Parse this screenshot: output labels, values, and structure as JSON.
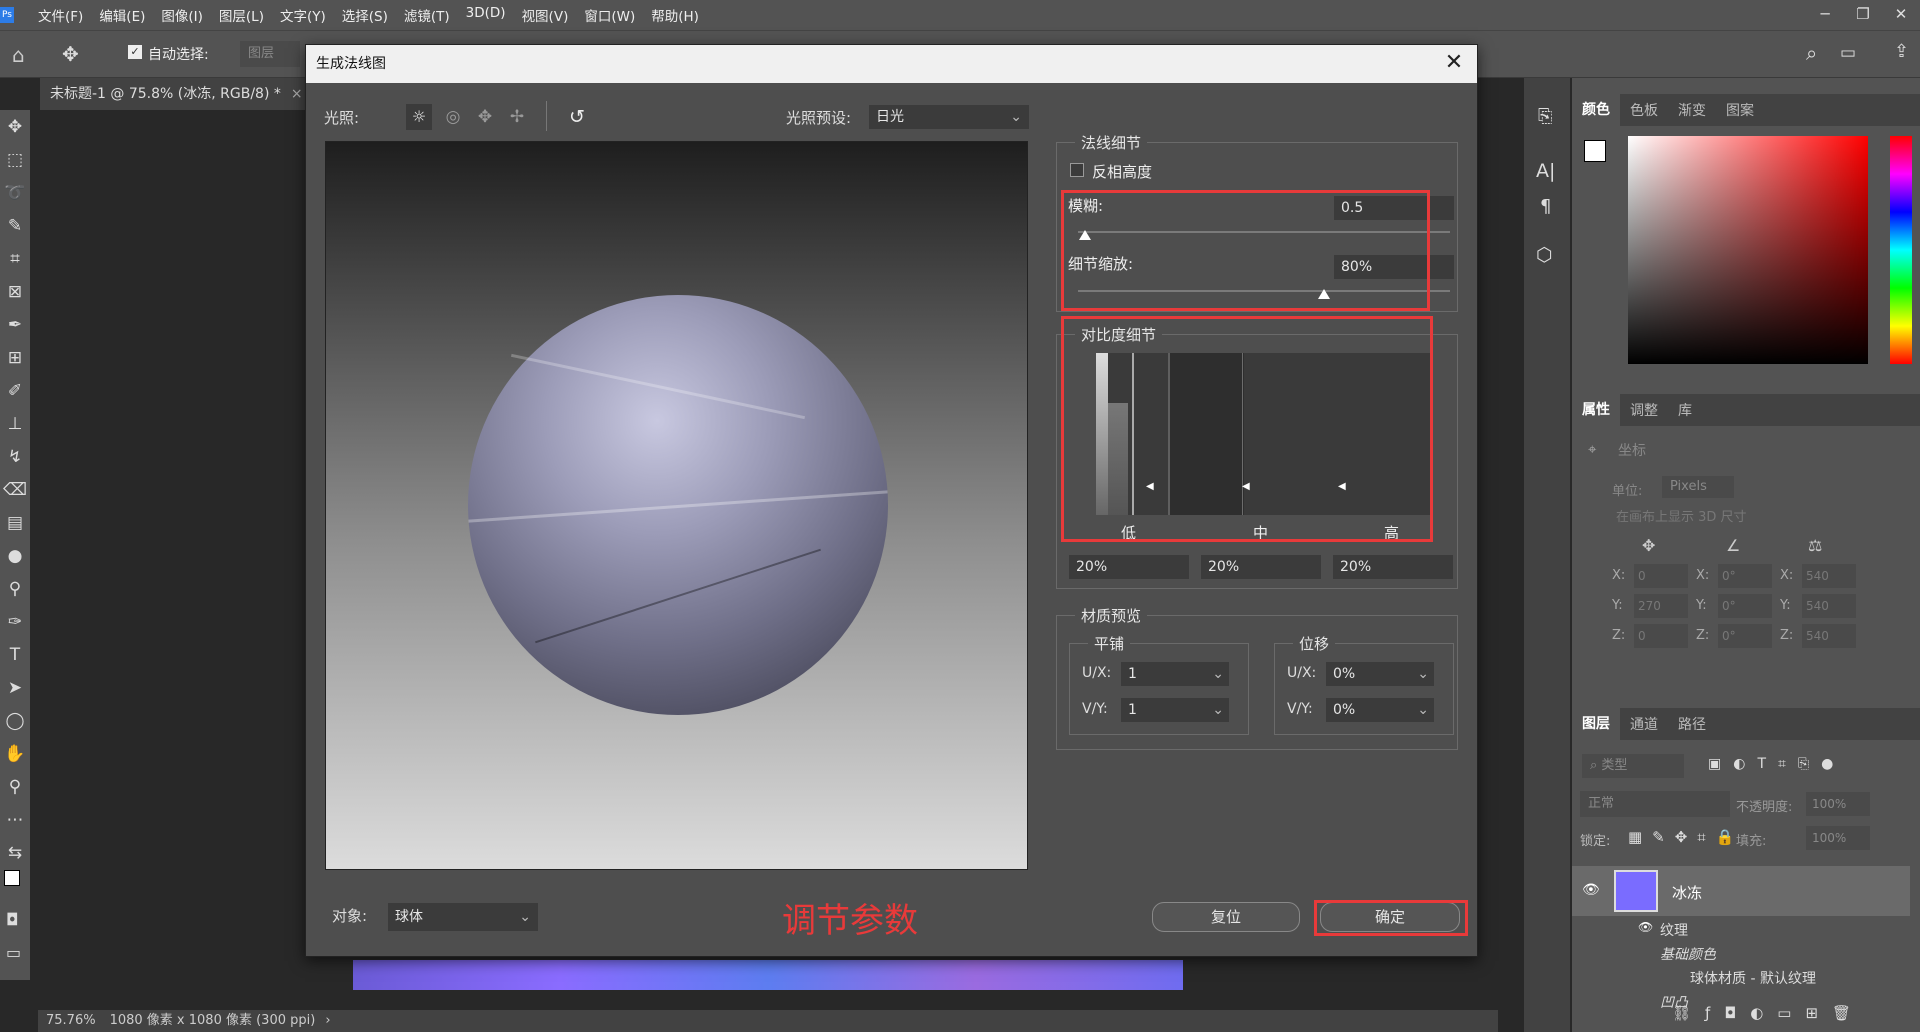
{
  "menu": [
    "文件(F)",
    "编辑(E)",
    "图像(I)",
    "图层(L)",
    "文字(Y)",
    "选择(S)",
    "滤镜(T)",
    "3D(D)",
    "视图(V)",
    "窗口(W)",
    "帮助(H)"
  ],
  "options": {
    "auto_select": "自动选择:",
    "layer_dd": "图层"
  },
  "doc_tab": "未标题-1 @ 75.8% (冰冻, RGB/8) *",
  "status": {
    "zoom": "75.76%",
    "info": "1080 像素 x 1080 像素 (300 ppi)"
  },
  "dialog": {
    "title": "生成法线图",
    "lighting_label": "光照:",
    "preset_label": "光照预设:",
    "preset_value": "日光",
    "object_label": "对象:",
    "object_value": "球体",
    "annotation": "调节参数",
    "reset": "复位",
    "ok": "确定",
    "normal_detail": {
      "title": "法线细节",
      "invert": "反相高度",
      "blur_label": "模糊:",
      "blur_value": "0.5",
      "blur_level": 0.02,
      "scale_label": "细节缩放:",
      "scale_value": "80%",
      "scale_level": 0.66
    },
    "contrast_detail": {
      "title": "对比度细节",
      "low": "低",
      "mid": "中",
      "high": "高",
      "v1": "20%",
      "v2": "20%",
      "v3": "20%"
    },
    "material": {
      "title": "材质预览",
      "tile": "平铺",
      "offset": "位移",
      "ux": "U/X:",
      "vy": "V/Y:",
      "tile_u": "1",
      "tile_v": "1",
      "off_u": "0%",
      "off_v": "0%"
    }
  },
  "panels": {
    "color_tabs": [
      "颜色",
      "色板",
      "渐变",
      "图案"
    ],
    "prop_tabs": [
      "属性",
      "调整",
      "库"
    ],
    "prop_title": "坐标",
    "unit_label": "单位:",
    "unit_value": "Pixels",
    "show3d": "在画布上显示 3D 尺寸",
    "x": "X:",
    "y": "Y:",
    "z": "Z:",
    "pos": [
      "0",
      "270",
      "0"
    ],
    "rot": [
      "0°",
      "0°",
      "0°"
    ],
    "scl": [
      "540",
      "540",
      "540"
    ],
    "layer_tabs": [
      "图层",
      "通道",
      "路径"
    ],
    "search": "类型",
    "blend": "正常",
    "opacity_label": "不透明度:",
    "opacity": "100%",
    "lock_label": "锁定:",
    "fill_label": "填充:",
    "fill": "100%",
    "layer_name": "冰冻",
    "texture": "纹理",
    "base_color": "基础颜色",
    "material_item": "球体材质 - 默认纹理",
    "cut": "凹凸"
  }
}
